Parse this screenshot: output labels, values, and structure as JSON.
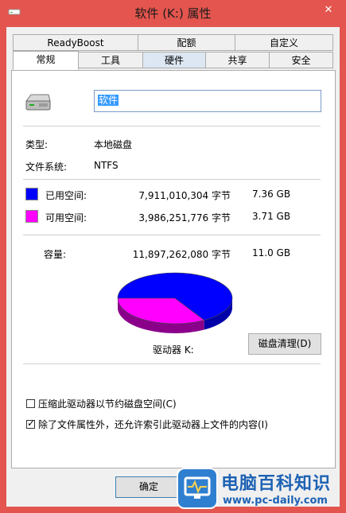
{
  "window": {
    "title": "软件 (K:) 属性",
    "close_glyph": "✕"
  },
  "tabs_top": [
    "ReadyBoost",
    "配额",
    "自定义"
  ],
  "tabs_bottom": [
    "常规",
    "工具",
    "硬件",
    "共享",
    "安全"
  ],
  "general": {
    "drive_name": "软件",
    "type_label": "类型:",
    "type_value": "本地磁盘",
    "fs_label": "文件系统:",
    "fs_value": "NTFS",
    "used_label": "已用空间:",
    "used_bytes": "7,911,010,304 字节",
    "used_gb": "7.36 GB",
    "free_label": "可用空间:",
    "free_bytes": "3,986,251,776 字节",
    "free_gb": "3.71 GB",
    "capacity_label": "容量:",
    "capacity_bytes": "11,897,262,080 字节",
    "capacity_gb": "11.0 GB",
    "drive_label": "驱动器 K:",
    "cleanup_button": "磁盘清理(D)",
    "compress_label": "压缩此驱动器以节约磁盘空间(C)",
    "compress_checked": false,
    "index_label": "除了文件属性外，还允许索引此驱动器上文件的内容(I)",
    "index_checked": true
  },
  "colors": {
    "used": "#0000ff",
    "free": "#ff00ff",
    "title_bar": "#e3554e"
  },
  "footer": {
    "ok": "确定"
  },
  "watermark": {
    "title": "电脑百科知识",
    "url": "www.pc-daily.com"
  }
}
